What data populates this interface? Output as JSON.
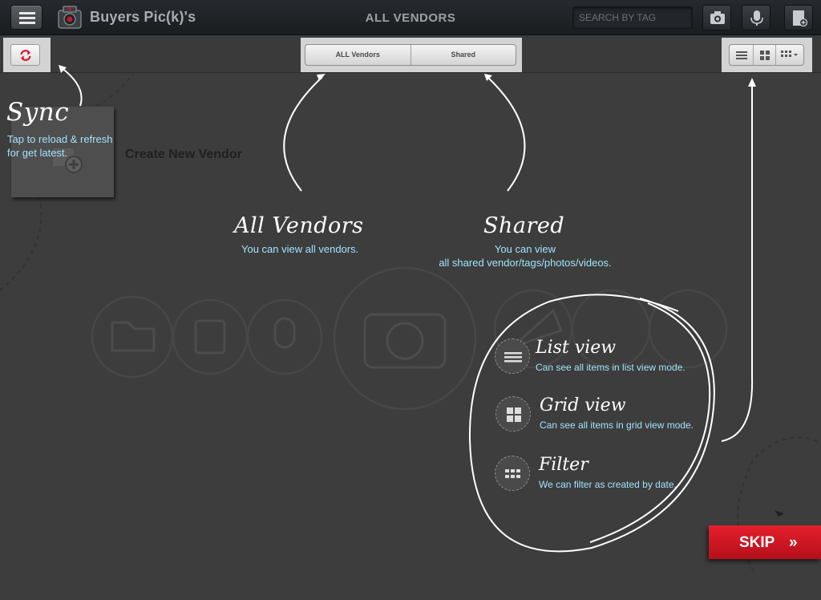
{
  "topbar": {
    "app_title": "Buyers Pic(k)'s",
    "page_title": "ALL VENDORS",
    "search_placeholder": "SEARCH BY TAG"
  },
  "subbar": {
    "tabs": [
      {
        "label": "ALL Vendors"
      },
      {
        "label": "Shared"
      }
    ]
  },
  "content": {
    "create_vendor_label": "Create New Vendor"
  },
  "coach": {
    "sync": {
      "title": "Sync",
      "line1": "Tap to reload & refresh",
      "line2": "for get latest."
    },
    "all_vendors": {
      "title": "All Vendors",
      "desc": "You can view all vendors."
    },
    "shared": {
      "title": "Shared",
      "line1": "You can view",
      "line2": "all shared vendor/tags/photos/videos."
    },
    "views": [
      {
        "title": "List view",
        "desc": "Can see all items in list view mode.",
        "icon": "list-icon"
      },
      {
        "title": "Grid view",
        "desc": "Can see all items in grid view mode.",
        "icon": "grid-icon"
      },
      {
        "title": "Filter",
        "desc": "We can filter as created by date.",
        "icon": "filter-icon"
      }
    ],
    "skip_label": "SKIP",
    "skip_arrow": "»"
  },
  "colors": {
    "accent_red": "#d9142a",
    "tip_blue": "#a2e3fb",
    "background": "#3d3d3d"
  }
}
